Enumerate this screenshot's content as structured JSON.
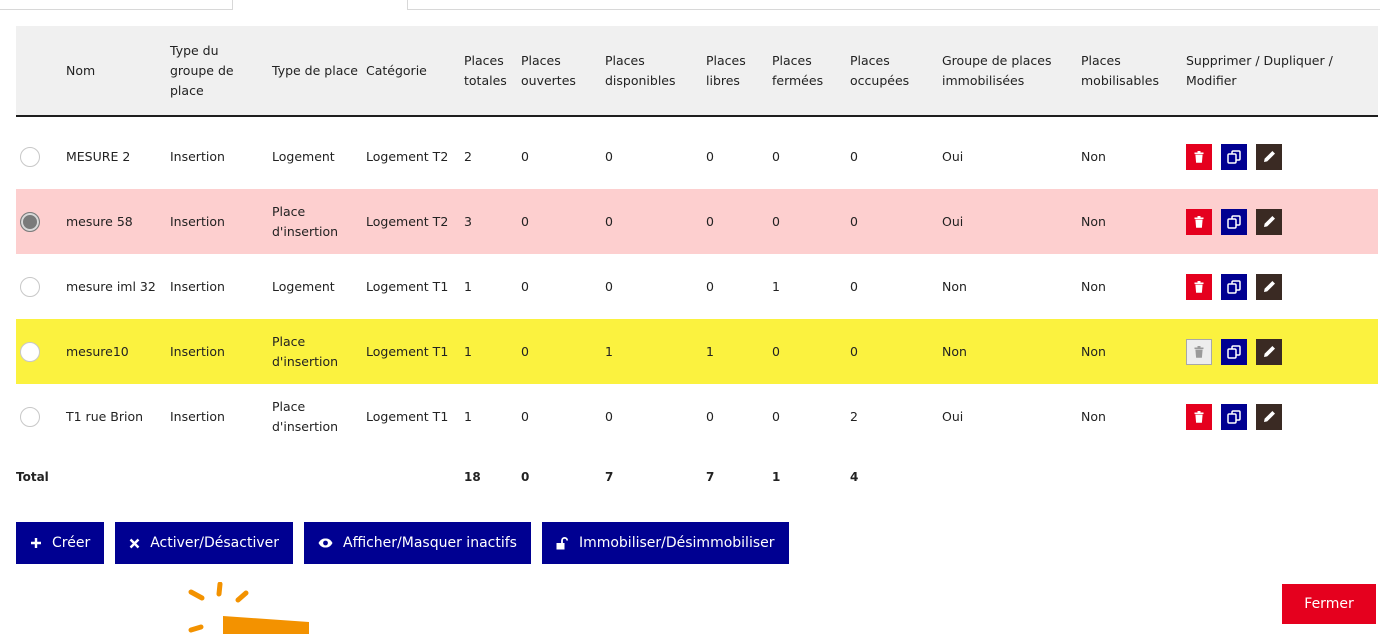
{
  "tabs": {
    "active_label": ""
  },
  "table": {
    "headers": [
      "Nom",
      "Type du groupe de place",
      "Type de place",
      "Catégorie",
      "Places totales",
      "Places ouvertes",
      "Places disponibles",
      "Places libres",
      "Places fermées",
      "Places occupées",
      "Groupe de places immobilisées",
      "Places mobilisables",
      "Supprimer / Dupliquer / Modifier"
    ],
    "rows": [
      {
        "selected": false,
        "nom": "MESURE 2",
        "type_groupe": "Insertion",
        "type_place": "Logement",
        "categorie": "Logement T2",
        "totales": "2",
        "ouvertes": "0",
        "disponibles": "0",
        "libres": "0",
        "fermees": "0",
        "occupees": "0",
        "immobilisees": "Oui",
        "mobilisables": "Non",
        "delete_enabled": true
      },
      {
        "selected": true,
        "nom": "mesure 58",
        "type_groupe": "Insertion",
        "type_place": "Place d'insertion",
        "categorie": "Logement T2",
        "totales": "3",
        "ouvertes": "0",
        "disponibles": "0",
        "libres": "0",
        "fermees": "0",
        "occupees": "0",
        "immobilisees": "Oui",
        "mobilisables": "Non",
        "delete_enabled": true
      },
      {
        "selected": false,
        "nom": "mesure iml 32",
        "type_groupe": "Insertion",
        "type_place": "Logement",
        "categorie": "Logement T1",
        "totales": "1",
        "ouvertes": "0",
        "disponibles": "0",
        "libres": "0",
        "fermees": "1",
        "occupees": "0",
        "immobilisees": "Non",
        "mobilisables": "Non",
        "delete_enabled": true
      },
      {
        "selected": false,
        "nom": "mesure10",
        "type_groupe": "Insertion",
        "type_place": "Place d'insertion",
        "categorie": "Logement T1",
        "totales": "1",
        "ouvertes": "0",
        "disponibles": "1",
        "libres": "1",
        "fermees": "0",
        "occupees": "0",
        "immobilisees": "Non",
        "mobilisables": "Non",
        "delete_enabled": false
      },
      {
        "selected": false,
        "nom": "T1 rue Brion",
        "type_groupe": "Insertion",
        "type_place": "Place d'insertion",
        "categorie": "Logement T1",
        "totales": "1",
        "ouvertes": "0",
        "disponibles": "0",
        "libres": "0",
        "fermees": "0",
        "occupees": "2",
        "immobilisees": "Oui",
        "mobilisables": "Non",
        "delete_enabled": true
      }
    ],
    "total": {
      "label": "Total",
      "totales": "18",
      "ouvertes": "0",
      "disponibles": "7",
      "libres": "7",
      "fermees": "1",
      "occupees": "4"
    }
  },
  "toolbar": {
    "create_label": "Créer",
    "toggle_label": "Activer/Désactiver",
    "show_inactive_label": "Afficher/Masquer inactifs",
    "immobilize_label": "Immobiliser/Désimmobiliser"
  },
  "close_label": "Fermer",
  "icons": [
    "plus-icon",
    "x-icon",
    "eye-icon",
    "unlock-icon",
    "trash-icon",
    "duplicate-icon",
    "pencil-icon"
  ],
  "colors": {
    "primary": "#000091",
    "danger": "#e5001e",
    "edit": "#3a2a23",
    "row_selected": "#fdcfcf",
    "row_highlight": "#fbf23f",
    "header_bg": "#f0f0f0",
    "annotation": "#f39200"
  }
}
